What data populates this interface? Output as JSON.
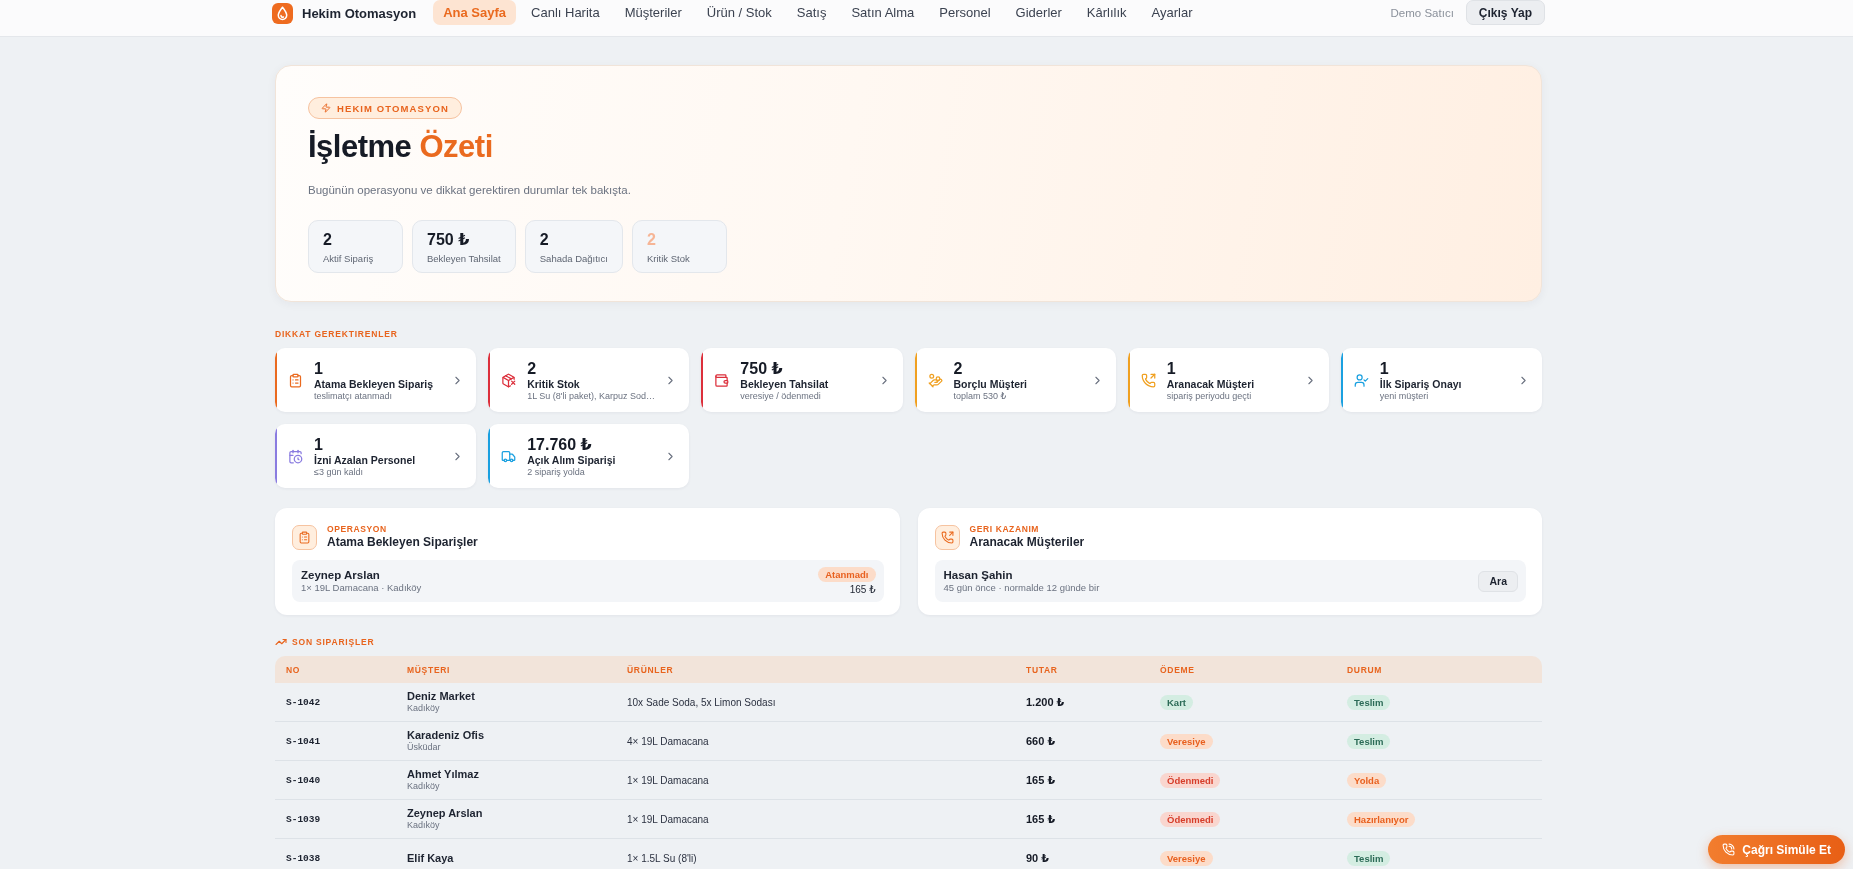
{
  "nav": {
    "brand": "Hekim Otomasyon",
    "items": [
      {
        "label": "Ana Sayfa",
        "selected": true
      },
      {
        "label": "Canlı Harita",
        "selected": false
      },
      {
        "label": "Müşteriler",
        "selected": false
      },
      {
        "label": "Ürün / Stok",
        "selected": false
      },
      {
        "label": "Satış",
        "selected": false
      },
      {
        "label": "Satın Alma",
        "selected": false
      },
      {
        "label": "Personel",
        "selected": false
      },
      {
        "label": "Giderler",
        "selected": false
      },
      {
        "label": "Kârlılık",
        "selected": false
      },
      {
        "label": "Ayarlar",
        "selected": false
      }
    ],
    "user": "Demo Satıcı",
    "logout": "Çıkış Yap"
  },
  "hero": {
    "badge": "HEKIM OTOMASYON",
    "title": "İşletme",
    "title_accent": "Özeti",
    "subtitle": "Bugünün operasyonu ve dikkat gerektiren durumlar tek bakışta.",
    "stats": [
      {
        "value": "2",
        "label": "Aktif Sipariş",
        "warning": false
      },
      {
        "value": "750 ₺",
        "label": "Bekleyen Tahsilat",
        "warning": false
      },
      {
        "value": "2",
        "label": "Sahada Dağıtıcı",
        "warning": false
      },
      {
        "value": "2",
        "label": "Kritik Stok",
        "warning": true
      }
    ]
  },
  "attention": {
    "heading": "DIKKAT GEREKTIRENLER",
    "cards": [
      {
        "value": "1",
        "title": "Atama Bekleyen Sipariş",
        "subtitle": "teslimatçı atanmadı",
        "color": "#ea6a1f"
      },
      {
        "value": "2",
        "title": "Kritik Stok",
        "subtitle": "1L Su (8'li paket), Karpuz Sod…",
        "color": "#dc2f3b"
      },
      {
        "value": "750 ₺",
        "title": "Bekleyen Tahsilat",
        "subtitle": "veresiye / ödenmedi",
        "color": "#dc2f3b"
      },
      {
        "value": "2",
        "title": "Borçlu Müşteri",
        "subtitle": "toplam 530 ₺",
        "color": "#f0a020"
      },
      {
        "value": "1",
        "title": "Aranacak Müşteri",
        "subtitle": "sipariş periyodu geçti",
        "color": "#f0a020"
      },
      {
        "value": "1",
        "title": "İlk Sipariş Onayı",
        "subtitle": "yeni müşteri",
        "color": "#1aa0e0"
      },
      {
        "value": "1",
        "title": "İzni Azalan Personel",
        "subtitle": "≤3 gün kaldı",
        "color": "#8a7ce0"
      },
      {
        "value": "17.760 ₺",
        "title": "Açık Alım Siparişi",
        "subtitle": "2 sipariş yolda",
        "color": "#1aa0e0"
      }
    ]
  },
  "panels": [
    {
      "eyebrow": "OPERASYON",
      "title": "Atama Bekleyen Siparişler",
      "rows": [
        {
          "name": "Zeynep Arslan",
          "detail": "1× 19L Damacana · Kadıköy",
          "badge": {
            "label": "Atanmadı",
            "kind": "warning"
          },
          "amount": "165 ₺"
        }
      ]
    },
    {
      "eyebrow": "GERI KAZANIM",
      "title": "Aranacak Müşteriler",
      "rows": [
        {
          "name": "Hasan Şahin",
          "detail": "45 gün önce · normalde 12 günde bir",
          "action": "Ara"
        }
      ]
    }
  ],
  "orders": {
    "heading": "SON SIPARIŞLER",
    "columns": [
      "NO",
      "MÜŞTERI",
      "ÜRÜNLER",
      "TUTAR",
      "ÖDEME",
      "DURUM"
    ],
    "rows": [
      {
        "no": "S-1042",
        "customer": "Deniz Market",
        "city": "Kadıköy",
        "products": "10x Sade Soda, 5x Limon Sodası",
        "amount": "1.200 ₺",
        "payment": {
          "label": "Kart",
          "kind": "success"
        },
        "status": {
          "label": "Teslim",
          "kind": "success"
        }
      },
      {
        "no": "S-1041",
        "customer": "Karadeniz Ofis",
        "city": "Üsküdar",
        "products": "4× 19L Damacana",
        "amount": "660 ₺",
        "payment": {
          "label": "Veresiye",
          "kind": "warning"
        },
        "status": {
          "label": "Teslim",
          "kind": "success"
        }
      },
      {
        "no": "S-1040",
        "customer": "Ahmet Yılmaz",
        "city": "Kadıköy",
        "products": "1× 19L Damacana",
        "amount": "165 ₺",
        "payment": {
          "label": "Ödenmedi",
          "kind": "danger"
        },
        "status": {
          "label": "Yolda",
          "kind": "warning"
        }
      },
      {
        "no": "S-1039",
        "customer": "Zeynep Arslan",
        "city": "Kadıköy",
        "products": "1× 19L Damacana",
        "amount": "165 ₺",
        "payment": {
          "label": "Ödenmedi",
          "kind": "danger"
        },
        "status": {
          "label": "Hazırlanıyor",
          "kind": "warning"
        }
      },
      {
        "no": "S-1038",
        "customer": "Elif Kaya",
        "products": "1× 1.5L Su (8'li)",
        "amount": "90 ₺",
        "payment": {
          "label": "Veresiye",
          "kind": "warning"
        },
        "status": {
          "label": "Teslim",
          "kind": "success"
        }
      }
    ]
  },
  "float_button": "Çağrı Simüle Et"
}
